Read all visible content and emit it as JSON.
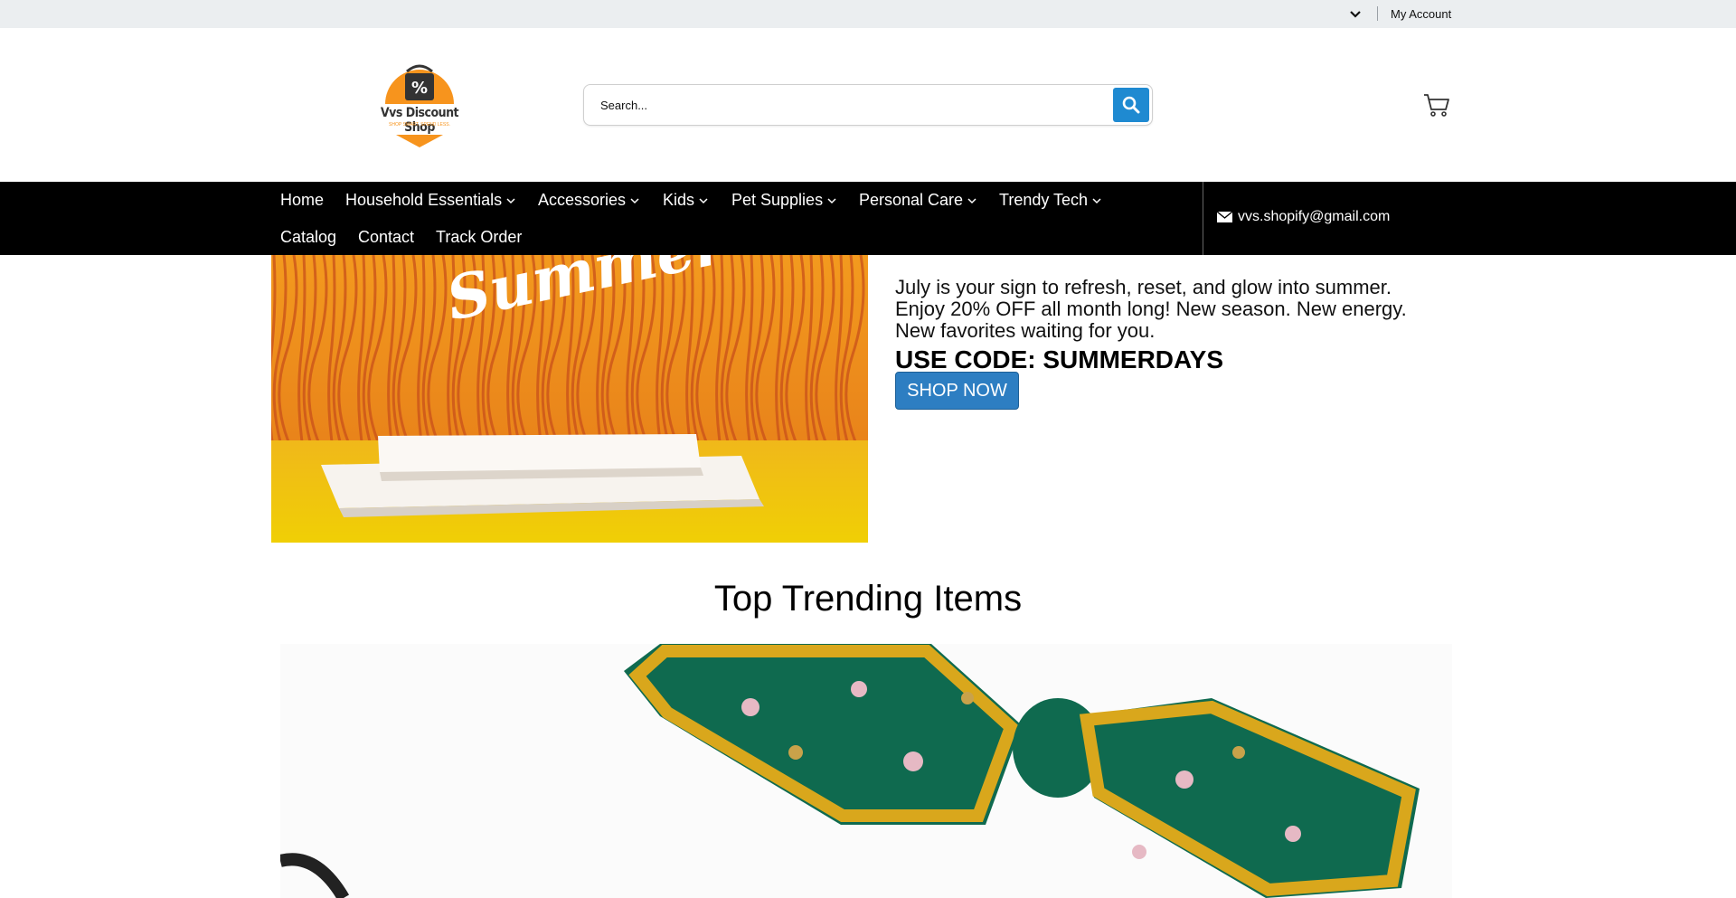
{
  "topbar": {
    "dropdown_icon": "chevron-down-icon",
    "account_label": "My Account"
  },
  "header": {
    "logo_text": "Vvs Discount Shop",
    "logo_tagline": "SHOP SMART. SPEND LESS.",
    "search_placeholder": "Search...",
    "search_icon": "search-icon",
    "cart_icon": "cart-icon",
    "accent_color": "#1f8ad1"
  },
  "nav": {
    "items": [
      {
        "label": "Home",
        "has_dropdown": false
      },
      {
        "label": "Household Essentials",
        "has_dropdown": true
      },
      {
        "label": "Accessories",
        "has_dropdown": true
      },
      {
        "label": "Kids",
        "has_dropdown": true
      },
      {
        "label": "Pet Supplies",
        "has_dropdown": true
      },
      {
        "label": "Personal Care",
        "has_dropdown": true
      },
      {
        "label": "Trendy Tech",
        "has_dropdown": true
      },
      {
        "label": "Catalog",
        "has_dropdown": false
      },
      {
        "label": "Contact",
        "has_dropdown": false
      },
      {
        "label": "Track Order",
        "has_dropdown": false
      }
    ],
    "email": "vvs.shopify@gmail.com",
    "email_icon": "mail-icon"
  },
  "hero": {
    "image_word": "Summer",
    "line1": "July is your sign to refresh, reset, and glow into summer.",
    "line2": "Enjoy 20% OFF all month long! New season. New energy.",
    "line3": "New favorites waiting for you.",
    "code_text": "USE CODE: SUMMERDAYS",
    "button_label": "SHOP NOW",
    "button_color": "#2d7ec2"
  },
  "trending": {
    "title": "Top Trending Items"
  }
}
